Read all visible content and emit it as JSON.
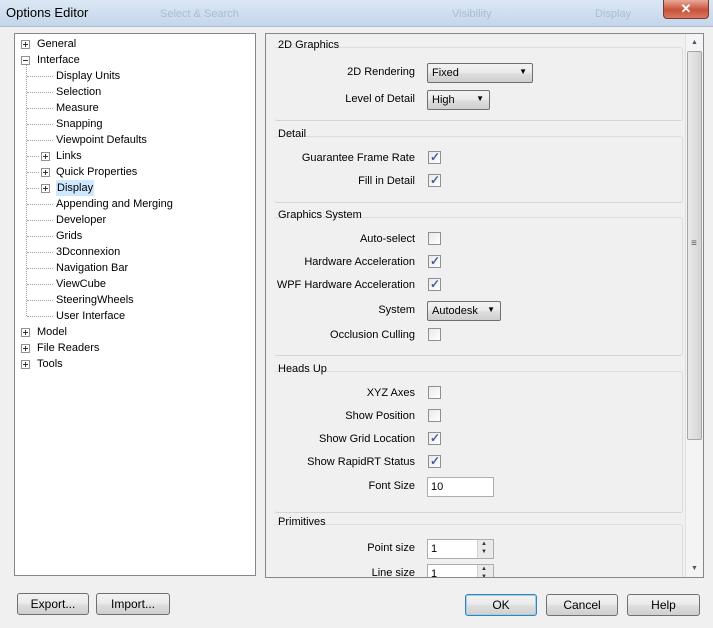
{
  "window": {
    "title": "Options Editor",
    "background_hints": [
      "Select & Search",
      "Visibility",
      "Display"
    ],
    "close_label": "✕"
  },
  "tree": {
    "items": [
      {
        "label": "General",
        "level": 0,
        "expander": "plus"
      },
      {
        "label": "Interface",
        "level": 0,
        "expander": "minus"
      },
      {
        "label": "Display Units",
        "level": 1,
        "expander": "none"
      },
      {
        "label": "Selection",
        "level": 1,
        "expander": "none"
      },
      {
        "label": "Measure",
        "level": 1,
        "expander": "none"
      },
      {
        "label": "Snapping",
        "level": 1,
        "expander": "none"
      },
      {
        "label": "Viewpoint Defaults",
        "level": 1,
        "expander": "none"
      },
      {
        "label": "Links",
        "level": 1,
        "expander": "plus"
      },
      {
        "label": "Quick Properties",
        "level": 1,
        "expander": "plus"
      },
      {
        "label": "Display",
        "level": 1,
        "expander": "plus",
        "selected": true
      },
      {
        "label": "Appending and Merging",
        "level": 1,
        "expander": "none"
      },
      {
        "label": "Developer",
        "level": 1,
        "expander": "none"
      },
      {
        "label": "Grids",
        "level": 1,
        "expander": "none"
      },
      {
        "label": "3Dconnexion",
        "level": 1,
        "expander": "none"
      },
      {
        "label": "Navigation Bar",
        "level": 1,
        "expander": "none"
      },
      {
        "label": "ViewCube",
        "level": 1,
        "expander": "none"
      },
      {
        "label": "SteeringWheels",
        "level": 1,
        "expander": "none"
      },
      {
        "label": "User Interface",
        "level": 1,
        "expander": "none"
      },
      {
        "label": "Model",
        "level": 0,
        "expander": "plus"
      },
      {
        "label": "File Readers",
        "level": 0,
        "expander": "plus"
      },
      {
        "label": "Tools",
        "level": 0,
        "expander": "plus"
      }
    ]
  },
  "sections": {
    "graphics2d": {
      "title": "2D Graphics",
      "rendering_label": "2D Rendering",
      "rendering_value": "Fixed",
      "lod_label": "Level of Detail",
      "lod_value": "High"
    },
    "detail": {
      "title": "Detail",
      "guarantee_label": "Guarantee Frame Rate",
      "guarantee_checked": true,
      "fill_label": "Fill in Detail",
      "fill_checked": true
    },
    "graphics_system": {
      "title": "Graphics System",
      "autoselect_label": "Auto-select",
      "autoselect_checked": false,
      "hw_label": "Hardware Acceleration",
      "hw_checked": true,
      "wpf_label": "WPF Hardware Acceleration",
      "wpf_checked": true,
      "system_label": "System",
      "system_value": "Autodesk",
      "occlusion_label": "Occlusion Culling",
      "occlusion_checked": false
    },
    "heads_up": {
      "title": "Heads Up",
      "xyz_label": "XYZ Axes",
      "xyz_checked": false,
      "pos_label": "Show Position",
      "pos_checked": false,
      "grid_label": "Show Grid Location",
      "grid_checked": true,
      "rapid_label": "Show RapidRT Status",
      "rapid_checked": true,
      "font_label": "Font Size",
      "font_value": "10"
    },
    "primitives": {
      "title": "Primitives",
      "point_label": "Point size",
      "point_value": "1",
      "line_label": "Line size",
      "line_value": "1"
    }
  },
  "buttons": {
    "export": "Export...",
    "import": "Import...",
    "ok": "OK",
    "cancel": "Cancel",
    "help": "Help"
  },
  "colors": {
    "selected_item_bg": "#cde8ff",
    "default_button_border": "#3c7fb1"
  }
}
